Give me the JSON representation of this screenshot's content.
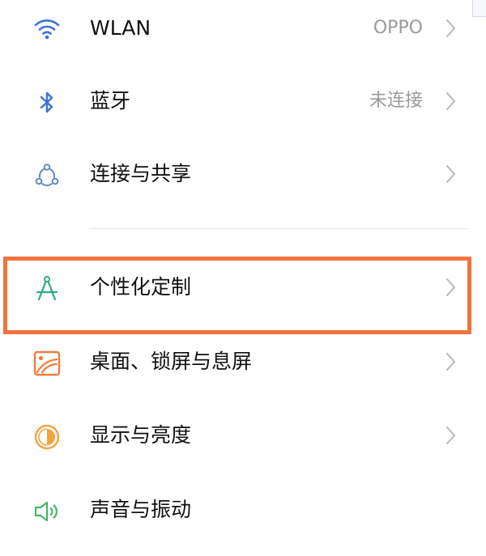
{
  "settings": {
    "items": [
      {
        "label": "WLAN",
        "value": "OPPO",
        "icon": "wifi-icon"
      },
      {
        "label": "蓝牙",
        "value": "未连接",
        "icon": "bluetooth-icon"
      },
      {
        "label": "连接与共享",
        "value": "",
        "icon": "share-icon"
      },
      {
        "label": "个性化定制",
        "value": "",
        "icon": "compass-icon"
      },
      {
        "label": "桌面、锁屏与息屏",
        "value": "",
        "icon": "wallpaper-icon"
      },
      {
        "label": "显示与亮度",
        "value": "",
        "icon": "brightness-icon"
      },
      {
        "label": "声音与振动",
        "value": "",
        "icon": "speaker-icon"
      }
    ]
  },
  "colors": {
    "wifi": "#3f73d6",
    "bluetooth": "#3f73d6",
    "share": "#6a86c4",
    "compass": "#2fa98a",
    "wallpaper": "#ef7d3a",
    "brightness": "#f4a340",
    "speaker": "#47b36a",
    "highlight": "#f0733e"
  }
}
